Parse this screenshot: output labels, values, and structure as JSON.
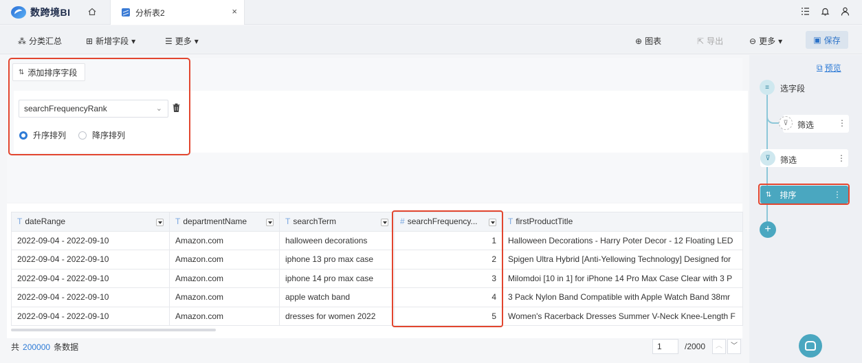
{
  "app": {
    "brand": "数跨境BI",
    "tab_title": "分析表2",
    "tab_close": "×"
  },
  "top_icons": [
    "☷",
    "🔔",
    "👤"
  ],
  "toolbar": {
    "group_summary": "分类汇总",
    "add_field": "新增字段",
    "more_left": "更多",
    "chart": "图表",
    "export": "导出",
    "more_right": "更多",
    "save": "保存"
  },
  "sort_panel": {
    "add_sort_label": "添加排序字段",
    "selected_field": "searchFrequencyRank",
    "asc_label": "升序排列",
    "desc_label": "降序排列",
    "selected_order": "asc"
  },
  "table": {
    "columns": [
      {
        "type": "T",
        "name": "dateRange"
      },
      {
        "type": "T",
        "name": "departmentName"
      },
      {
        "type": "T",
        "name": "searchTerm"
      },
      {
        "type": "#",
        "name": "searchFrequency..."
      },
      {
        "type": "T",
        "name": "firstProductTitle"
      }
    ],
    "rows": [
      [
        "2022-09-04 - 2022-09-10",
        "Amazon.com",
        "halloween decorations",
        "1",
        "Halloween Decorations - Harry Poter Decor - 12 Floating LED"
      ],
      [
        "2022-09-04 - 2022-09-10",
        "Amazon.com",
        "iphone 13 pro max case",
        "2",
        "Spigen Ultra Hybrid [Anti-Yellowing Technology] Designed for"
      ],
      [
        "2022-09-04 - 2022-09-10",
        "Amazon.com",
        "iphone 14 pro max case",
        "3",
        "Milomdoi [10 in 1] for iPhone 14 Pro Max Case Clear with 3 P"
      ],
      [
        "2022-09-04 - 2022-09-10",
        "Amazon.com",
        "apple watch band",
        "4",
        "3 Pack Nylon Band Compatible with Apple Watch Band 38mr"
      ],
      [
        "2022-09-04 - 2022-09-10",
        "Amazon.com",
        "dresses for women 2022",
        "5",
        "Women's Racerback Dresses Summer V-Neck Knee-Length F"
      ]
    ]
  },
  "footer": {
    "prefix": "共",
    "count": "200000",
    "suffix": "条数据",
    "page": "1",
    "total_pages": "/2000"
  },
  "flow": {
    "preview": "预览",
    "select_fields": "选字段",
    "filter_branch": "筛选",
    "filter": "筛选",
    "sort": "排序",
    "add": "+"
  }
}
